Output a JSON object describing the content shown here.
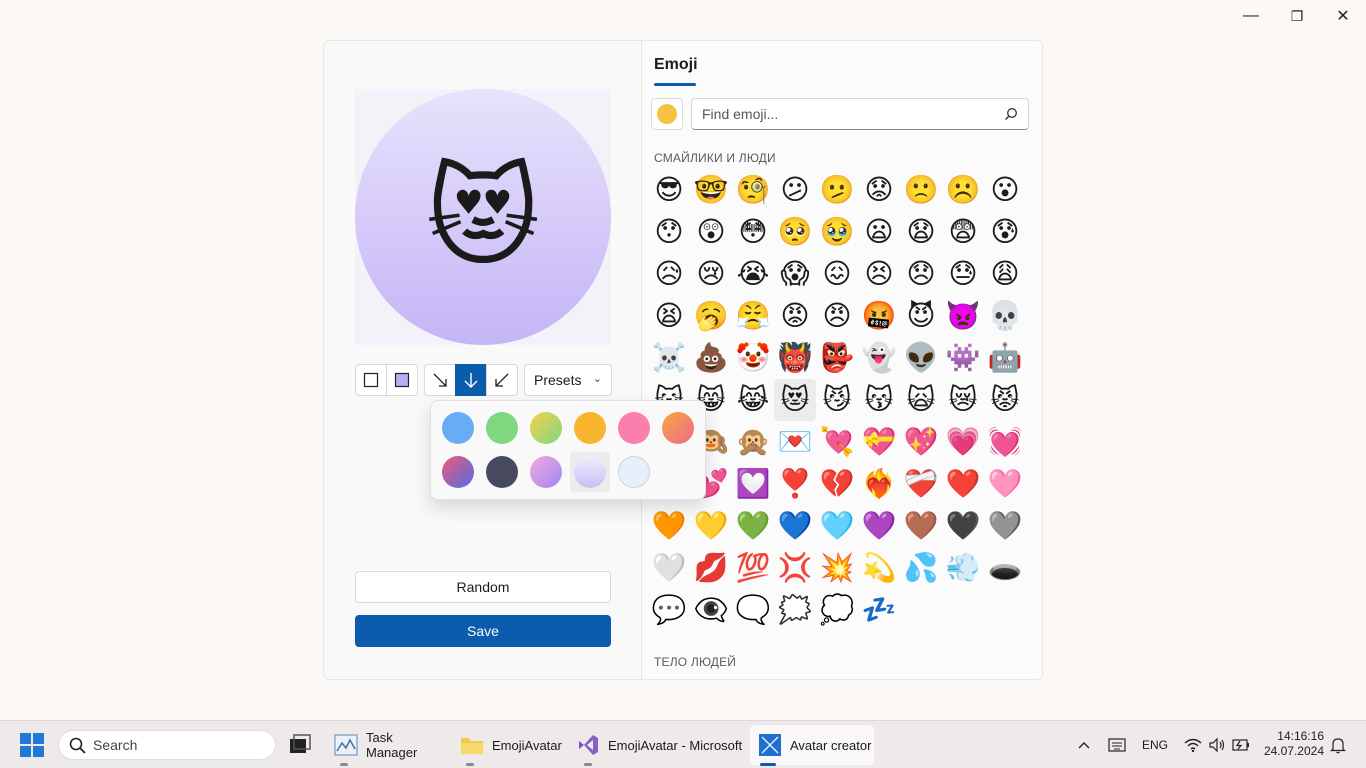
{
  "window": {
    "minimize_glyph": "—",
    "maximize_glyph": "❐",
    "close_glyph": "✕"
  },
  "left": {
    "preview_emoji": "😻",
    "preview_gradient": [
      "#e8e2fb",
      "#c4b5f6"
    ],
    "presets_label": "Presets",
    "random_label": "Random",
    "save_label": "Save",
    "accent": "#0b5cad"
  },
  "presets": {
    "swatches": [
      {
        "name": "blue",
        "color": "#66adf6"
      },
      {
        "name": "green",
        "color": "#7fd77f"
      },
      {
        "name": "lime-yellow",
        "color": "linear-gradient(135deg,#f4d24a,#7fd77f)"
      },
      {
        "name": "orange",
        "color": "#f9b42e"
      },
      {
        "name": "pink",
        "color": "#fb7fac"
      },
      {
        "name": "coral",
        "color": "linear-gradient(135deg,#f4a640,#f16a8a)"
      },
      {
        "name": "blue-pink",
        "color": "linear-gradient(135deg,#f0587a,#4d6fe6)"
      },
      {
        "name": "slate",
        "color": "#474a5e"
      },
      {
        "name": "lavender-pink",
        "color": "linear-gradient(135deg,#f4a8e0,#9f88f0)"
      },
      {
        "name": "lavender",
        "color": "linear-gradient(180deg,#f2eefc,#c9bdf6)"
      },
      {
        "name": "light-blue",
        "color": "#e6f0fb"
      }
    ]
  },
  "emoji_panel": {
    "tab_label": "Emoji",
    "search_placeholder": "Find emoji...",
    "section_smileys": "СМАЙЛИКИ И ЛЮДИ",
    "section_body": "ТЕЛО ЛЮДЕЙ",
    "selected_color": "#f5c242",
    "emojis": [
      "😎",
      "🤓",
      "🧐",
      "😕",
      "🫤",
      "😟",
      "🙁",
      "☹️",
      "😮",
      "😯",
      "😲",
      "😳",
      "🥺",
      "🥹",
      "😦",
      "😧",
      "😨",
      "😰",
      "😥",
      "😢",
      "😭",
      "😱",
      "😖",
      "😣",
      "😞",
      "😓",
      "😩",
      "😫",
      "🥱",
      "😤",
      "😡",
      "😠",
      "🤬",
      "😈",
      "👿",
      "💀",
      "☠️",
      "💩",
      "🤡",
      "👹",
      "👺",
      "👻",
      "👽",
      "👾",
      "🤖",
      "😺",
      "😸",
      "😹",
      "😻",
      "😼",
      "😽",
      "🙀",
      "😿",
      "😾",
      "🙈",
      "🙉",
      "🙊",
      "💌",
      "💘",
      "💝",
      "💖",
      "💗",
      "💓",
      "💞",
      "💕",
      "💟",
      "❣️",
      "💔",
      "❤️‍🔥",
      "❤️‍🩹",
      "❤️",
      "🩷",
      "🧡",
      "💛",
      "💚",
      "💙",
      "🩵",
      "💜",
      "🤎",
      "🖤",
      "🩶",
      "🤍",
      "💋",
      "💯",
      "💢",
      "💥",
      "💫",
      "💦",
      "💨",
      "🕳️",
      "💬",
      "👁️‍🗨️",
      "🗨️",
      "🗯️",
      "💭",
      "💤"
    ]
  },
  "taskbar": {
    "search_label": "Search",
    "apps": [
      {
        "label": "Task Manager"
      },
      {
        "label": "EmojiAvatar"
      },
      {
        "label": "EmojiAvatar - Microsoft"
      },
      {
        "label": "Avatar creator"
      }
    ],
    "language": "ENG",
    "time": "14:16:16",
    "date": "24.07.2024"
  }
}
